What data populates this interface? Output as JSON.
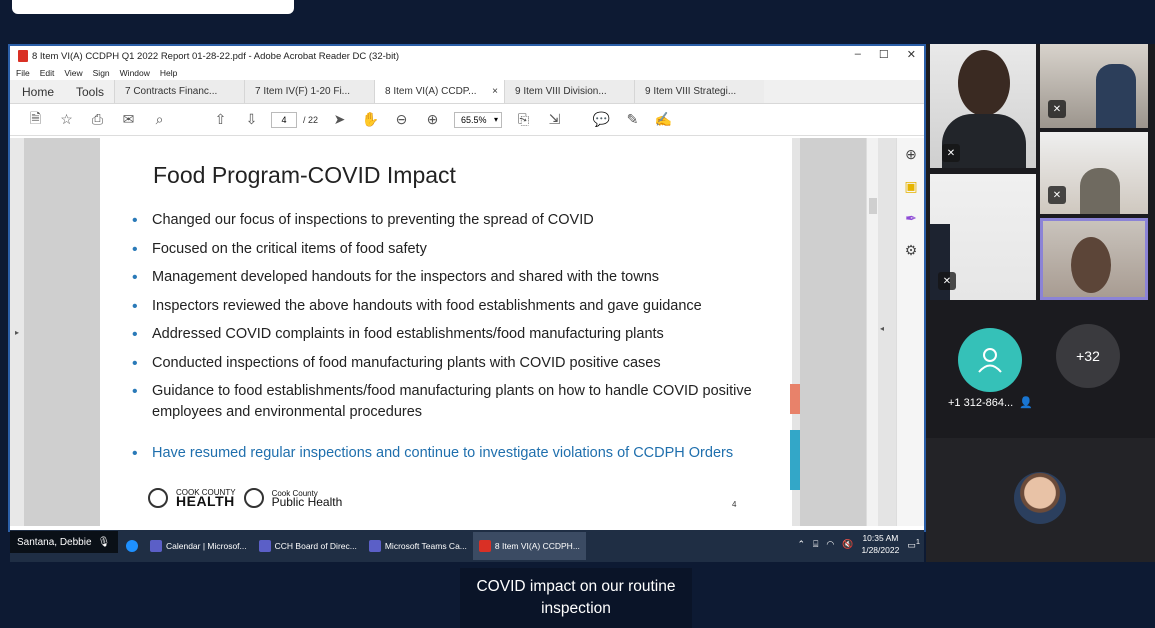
{
  "window": {
    "title": "8 Item VI(A) CCDPH Q1 2022 Report 01-28-22.pdf - Adobe Acrobat Reader DC (32-bit)",
    "controls": [
      "–",
      "☐",
      "✕"
    ]
  },
  "menu": [
    "File",
    "Edit",
    "View",
    "Sign",
    "Window",
    "Help"
  ],
  "tabs": {
    "home": "Home",
    "tools": "Tools",
    "docs": [
      {
        "label": "7 Contracts Financ..."
      },
      {
        "label": "7 Item IV(F) 1-20 Fi..."
      },
      {
        "label": "8 Item VI(A) CCDP...",
        "active": true
      },
      {
        "label": "9 Item VIII Division..."
      },
      {
        "label": "9 Item VIII Strategi..."
      }
    ],
    "close_glyph": "×"
  },
  "toolbar": {
    "page_current": "4",
    "page_total": "/ 22",
    "zoom": "65.5%"
  },
  "slide": {
    "title": "Food Program-COVID Impact",
    "bullets": [
      "Changed our focus of inspections to preventing the spread of COVID",
      "Focused on the critical items of food safety",
      "Management developed handouts for the inspectors and shared with the towns",
      "Inspectors reviewed the above handouts with food establishments and gave guidance",
      "Addressed COVID complaints in food establishments/food manufacturing plants",
      "Conducted inspections of food manufacturing plants with COVID positive cases",
      "Guidance to food establishments/food manufacturing plants on how to handle COVID positive employees and environmental procedures"
    ],
    "highlight_bullet": "Have resumed regular inspections and continue to investigate violations of CCDPH Orders",
    "logo1_top": "COOK COUNTY",
    "logo1_bottom": "HEALTH",
    "logo2_top": "Cook County",
    "logo2_bottom": "Public Health",
    "page_number": "4"
  },
  "presenter": {
    "name": "Santana, Debbie"
  },
  "taskbar": {
    "items": [
      {
        "label": "Calendar | Microsof..."
      },
      {
        "label": "CCH Board of Direc..."
      },
      {
        "label": "Microsoft Teams Ca..."
      },
      {
        "label": "8 Item VI(A) CCDPH...",
        "active": true
      }
    ],
    "time": "10:35 AM",
    "date": "1/28/2022",
    "notification_count": "1"
  },
  "participants": {
    "phone_label": "+1 312-864...",
    "more_count": "+32"
  },
  "caption": {
    "text": "COVID impact on our routine inspection"
  },
  "colors": {
    "bullet_blue": "#2a7ab8",
    "highlight_text": "#1f6fad",
    "accent_orange": "#e8826a",
    "accent_teal": "#33a7c8",
    "avatar_teal": "#35c1b8",
    "share_border": "#2b5fa8"
  }
}
